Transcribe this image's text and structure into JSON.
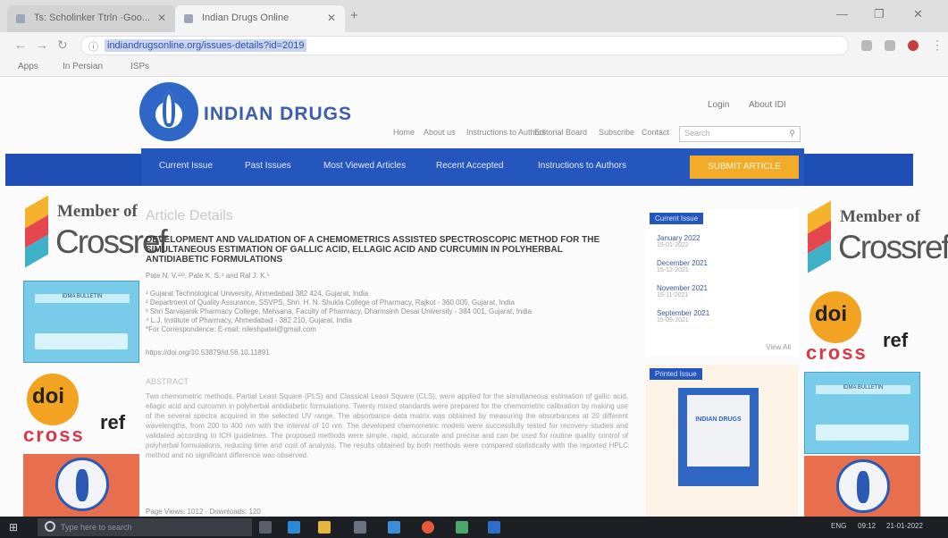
{
  "browser": {
    "tabs": [
      {
        "label": "Ts: Scholinker Ttrln ·Goo..."
      },
      {
        "label": "Indian Drugs Online"
      }
    ],
    "new_tab": "+",
    "url": "indiandrugsonline.org/issues-details?id=2019",
    "bookmarks": [
      "Apps",
      "In Persian",
      "ISPs"
    ],
    "window_controls": [
      "—",
      "❐",
      "✕"
    ]
  },
  "site": {
    "brand": "INDIAN DRUGS",
    "top_links": [
      "Login",
      "About IDI"
    ],
    "secondary_nav": [
      "Home",
      "About us",
      "Instructions to Authors",
      "Editorial Board",
      "Subscribe",
      "Contact"
    ],
    "search_placeholder": "Search",
    "main_nav": [
      "Current Issue",
      "Past Issues",
      "Most Viewed Articles",
      "Recent Accepted",
      "Instructions to Authors"
    ],
    "submit_label": "SUBMIT ARTICLE"
  },
  "side": {
    "member_of": "Member of",
    "crossref": "Crossref",
    "bulletin_title": "IDMA BULLETIN",
    "doi": "doi",
    "cross": "cross",
    "ref": "ref"
  },
  "article": {
    "heading": "Article Details",
    "title": "DEVELOPMENT AND VALIDATION OF A CHEMOMETRICS ASSISTED SPECTROSCOPIC METHOD FOR THE SIMULTANEOUS ESTIMATION OF GALLIC ACID, ELLAGIC ACID AND CURCUMIN IN POLYHERBAL ANTIDIABETIC FORMULATIONS",
    "authors": "Pate N. V.¹²³, Pate K. S.⁴ and Ral J. K.⁵",
    "affiliations": [
      "¹ Gujarat Technological University, Ahmedabad 382 424, Gujarat, India",
      "² Department of Quality Assurance, SSVPS, Shri. H. N. Shukla College of Pharmacy, Rajkot - 360 005, Gujarat, India",
      "³ Shri Sarvajanik Pharmacy College, Mehsana, Faculty of Pharmacy, Dharmsinh Desai University - 384 001, Gujarat, India",
      "⁴ L.J. Institute of Pharmacy, Ahmedabad - 382 210, Gujarat, India",
      "*For Correspondence: E-mail: nileshpatel@gmail.com"
    ],
    "doi_line": "https://doi.org/10.53879/id.56.10.11891",
    "abstract_heading": "ABSTRACT",
    "abstract": "Two chemometric methods, Partial Least Square (PLS) and Classical Least Square (CLS), were applied for the simultaneous estimation of gallic acid, ellagic acid and curcumin in polyherbal antidiabetic formulations. Twenty mixed standards were prepared for the chemometric calibration by making use of the several spectra acquired in the selected UV range. The absorbance data matrix was obtained by measuring the absorbances at 20 different wavelengths, from 200 to 400 nm with the interval of 10 nm. The developed chemometric models were successfully tested for recovery studies and validated according to ICH guidelines. The proposed methods were simple, rapid, accurate and precise and can be used for routine quality control of polyherbal formulations, reducing time and cost of analysis. The results obtained by both methods were compared statistically with the reported HPLC method and no significant difference was observed.",
    "more": "Page Views: 1012 · Downloads: 120"
  },
  "current_issue": {
    "title": "Current Issue",
    "issues": [
      {
        "label": "January 2022",
        "date": "15-01-2022"
      },
      {
        "label": "December 2021",
        "date": "15-12-2021"
      },
      {
        "label": "November 2021",
        "date": "15-11-2021"
      },
      {
        "label": "September 2021",
        "date": "15-09-2021"
      }
    ],
    "view_all": "View All"
  },
  "printed_issue": {
    "title": "Printed Issue",
    "cover_title": "INDIAN DRUGS"
  },
  "taskbar": {
    "search_placeholder": "Type here to search",
    "tray_items": [
      "ENG",
      "09:12",
      "21-01-2022"
    ]
  }
}
